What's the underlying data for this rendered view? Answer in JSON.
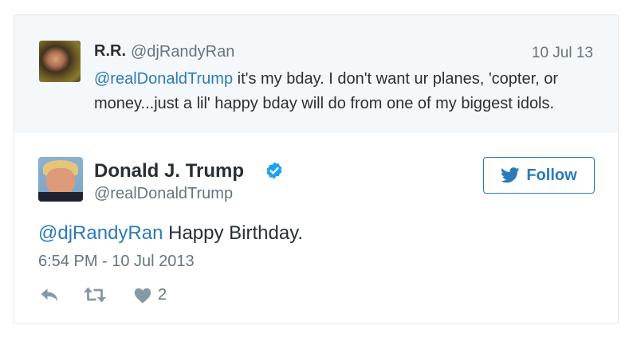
{
  "quoted_tweet": {
    "display_name": "R.R.",
    "handle": "@djRandyRan",
    "date": "10 Jul 13",
    "mention": "@realDonaldTrump",
    "text": " it's my bday. I don't want ur planes, 'copter, or money...just a lil' happy bday will do from one of my biggest idols."
  },
  "tweet": {
    "display_name": "Donald J. Trump",
    "handle": "@realDonaldTrump",
    "verified_icon": "verified-badge-icon",
    "mention": "@djRandyRan",
    "text": " Happy Birthday.",
    "timestamp": "6:54 PM - 10 Jul 2013"
  },
  "follow_button": {
    "label": "Follow",
    "icon": "twitter-bird-icon"
  },
  "actions": {
    "reply_icon": "reply-icon",
    "retweet_icon": "retweet-icon",
    "like_icon": "heart-icon",
    "like_count": "2"
  },
  "colors": {
    "link": "#2b7bb9",
    "verified": "#1da1f2",
    "muted": "#66757f",
    "quoted_bg": "#f5f8fa"
  }
}
